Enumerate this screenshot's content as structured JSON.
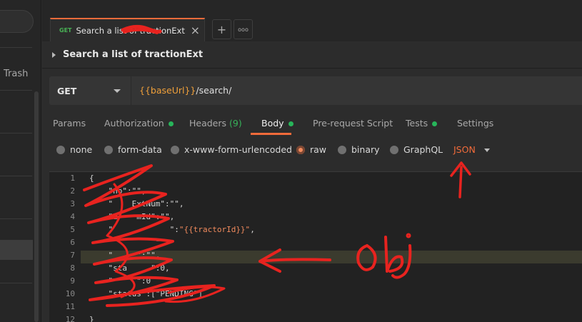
{
  "sidebar": {
    "trash_label": "Trash"
  },
  "tabbar": {
    "tab": {
      "method": "GET",
      "title": "Search a list of tractionExt"
    },
    "close_icon": "×",
    "add_icon": "+",
    "more_icon": "ooo"
  },
  "request": {
    "title": "Search a list of tractionExt",
    "method": "GET",
    "url_variable": "{{baseUrl}}",
    "url_path": "/search/"
  },
  "subtabs": {
    "params": "Params",
    "authorization": "Authorization",
    "headers": "Headers",
    "headers_count": "(9)",
    "body": "Body",
    "prerequest": "Pre-request Script",
    "tests": "Tests",
    "settings": "Settings",
    "indicator_color": "#27b55a",
    "active_color": "#f26b3a"
  },
  "body_types": {
    "none": "none",
    "form_data": "form-data",
    "urlencoded": "x-www-form-urlencoded",
    "raw": "raw",
    "binary": "binary",
    "graphql": "GraphQL",
    "format": "JSON",
    "selected": "raw"
  },
  "editor": {
    "line_numbers": [
      "1",
      "2",
      "3",
      "4",
      "5",
      "6",
      "7",
      "8",
      "9",
      "10",
      "11",
      "12"
    ],
    "lines": [
      {
        "text": "{"
      },
      {
        "text": "    \"no\":\"\","
      },
      {
        "text": "    \"    ExtNum\":\"\","
      },
      {
        "text": "    \"d    mId\":\"\","
      },
      {
        "text": "    \"            \":",
        "var": "\"{{tractorId}}\"",
        "after": ","
      },
      {
        "text": "    \"         \""
      },
      {
        "text": "    \"     \":\"\","
      },
      {
        "text": "    \"sta     \":0,"
      },
      {
        "text": "    \"     \":0"
      },
      {
        "text": "    \"status\":[\"PENDING\"]"
      },
      {
        "text": ""
      },
      {
        "text": "}"
      }
    ]
  },
  "annotation": {
    "handwritten_text": "obj"
  }
}
